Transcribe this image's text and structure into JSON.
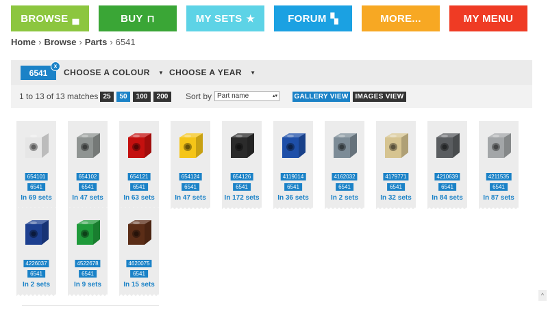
{
  "nav": [
    {
      "label": "BROWSE",
      "icon": "brick-icon",
      "color": "#8cc63f"
    },
    {
      "label": "BUY",
      "icon": "basket-icon",
      "color": "#3aa636"
    },
    {
      "label": "MY SETS",
      "icon": "star-icon",
      "color": "#5dd3e6"
    },
    {
      "label": "FORUM",
      "icon": "chat-bubbles-icon",
      "color": "#1ba1e2"
    },
    {
      "label": "MORE...",
      "icon": "",
      "color": "#f7a823"
    },
    {
      "label": "MY MENU",
      "icon": "",
      "color": "#ef3b24"
    }
  ],
  "breadcrumb": {
    "items": [
      "Home",
      "Parts"
    ],
    "middle": "Browse",
    "current": "6541",
    "sep": "›"
  },
  "filter": {
    "chip": "6541",
    "chip_remove": "x",
    "colour": "CHOOSE A COLOUR",
    "year": "CHOOSE A YEAR"
  },
  "results": {
    "matches": "1 to 13 of 13 matches",
    "page_sizes": [
      "25",
      "50",
      "100",
      "200"
    ],
    "active_page_size": "50",
    "sort_label": "Sort by",
    "sort_value": "Part name",
    "gallery": "GALLERY VIEW",
    "images": "IMAGES VIEW"
  },
  "parts": [
    {
      "element": "654101",
      "design": "6541",
      "sets": "In 69 sets",
      "color": "#e6e6e6"
    },
    {
      "element": "654102",
      "design": "6541",
      "sets": "In 47 sets",
      "color": "#8f9492"
    },
    {
      "element": "654121",
      "design": "6541",
      "sets": "In 63 sets",
      "color": "#c4100f"
    },
    {
      "element": "654124",
      "design": "6541",
      "sets": "In 47 sets",
      "color": "#f5c518"
    },
    {
      "element": "654126",
      "design": "6541",
      "sets": "In 172 sets",
      "color": "#2b2b2b"
    },
    {
      "element": "4119014",
      "design": "6541",
      "sets": "In 36 sets",
      "color": "#1e4fa8"
    },
    {
      "element": "4162032",
      "design": "6541",
      "sets": "In 2 sets",
      "color": "#7d8c97"
    },
    {
      "element": "4179771",
      "design": "6541",
      "sets": "In 32 sets",
      "color": "#d6c491"
    },
    {
      "element": "4210639",
      "design": "6541",
      "sets": "In 84 sets",
      "color": "#5a5d60"
    },
    {
      "element": "4211535",
      "design": "6541",
      "sets": "In 87 sets",
      "color": "#a3a6a8"
    },
    {
      "element": "4226037",
      "design": "6541",
      "sets": "In 2 sets",
      "color": "#1d3f8f"
    },
    {
      "element": "4522678",
      "design": "6541",
      "sets": "In 9 sets",
      "color": "#1f9a3a"
    },
    {
      "element": "4620075",
      "design": "6541",
      "sets": "In 15 sets",
      "color": "#5b2d17"
    }
  ]
}
